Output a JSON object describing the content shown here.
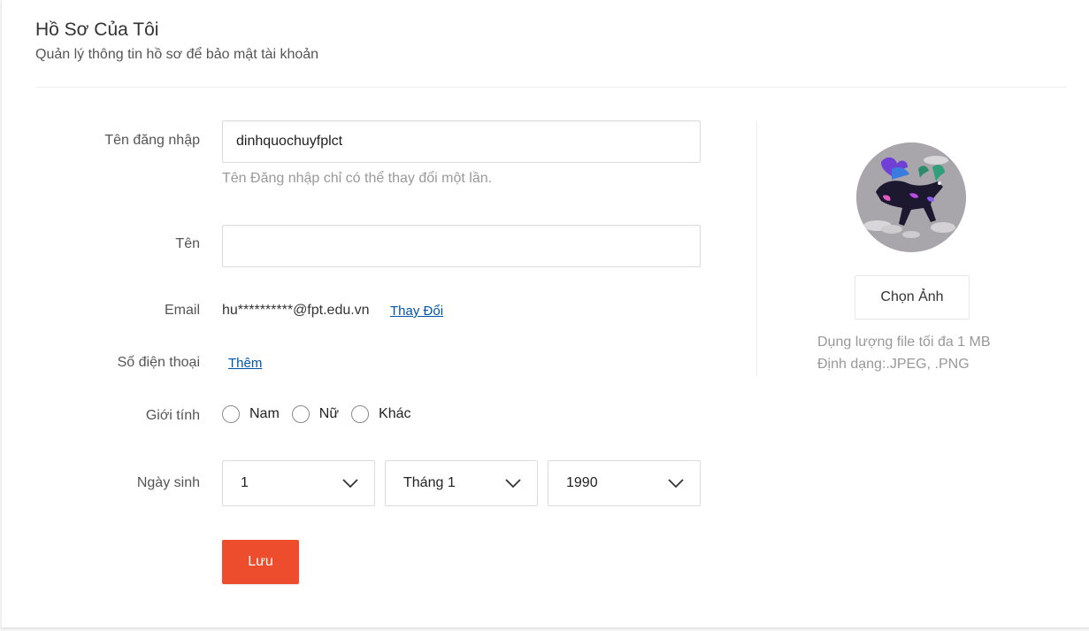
{
  "header": {
    "title": "Hồ Sơ Của Tôi",
    "subtitle": "Quản lý thông tin hồ sơ để bảo mật tài khoản"
  },
  "form": {
    "username": {
      "label": "Tên đăng nhập",
      "value": "dinhquochuyfplct",
      "hint": "Tên Đăng nhập chỉ có thể thay đổi một lần."
    },
    "name": {
      "label": "Tên",
      "value": ""
    },
    "email": {
      "label": "Email",
      "value": "hu**********@fpt.edu.vn",
      "change_link": "Thay Đổi"
    },
    "phone": {
      "label": "Số điện thoại",
      "add_link": "Thêm"
    },
    "gender": {
      "label": "Giới tính",
      "options": [
        "Nam",
        "Nữ",
        "Khác"
      ]
    },
    "birthday": {
      "label": "Ngày sinh",
      "day": "1",
      "month": "Tháng 1",
      "year": "1990"
    },
    "save_label": "Lưu"
  },
  "avatar": {
    "choose_label": "Chọn Ảnh",
    "hint_size": "Dụng lượng file tối đa 1 MB",
    "hint_format": "Định dạng:.JPEG, .PNG"
  },
  "colors": {
    "primary": "#ee4d2d",
    "link": "#0055aa"
  }
}
